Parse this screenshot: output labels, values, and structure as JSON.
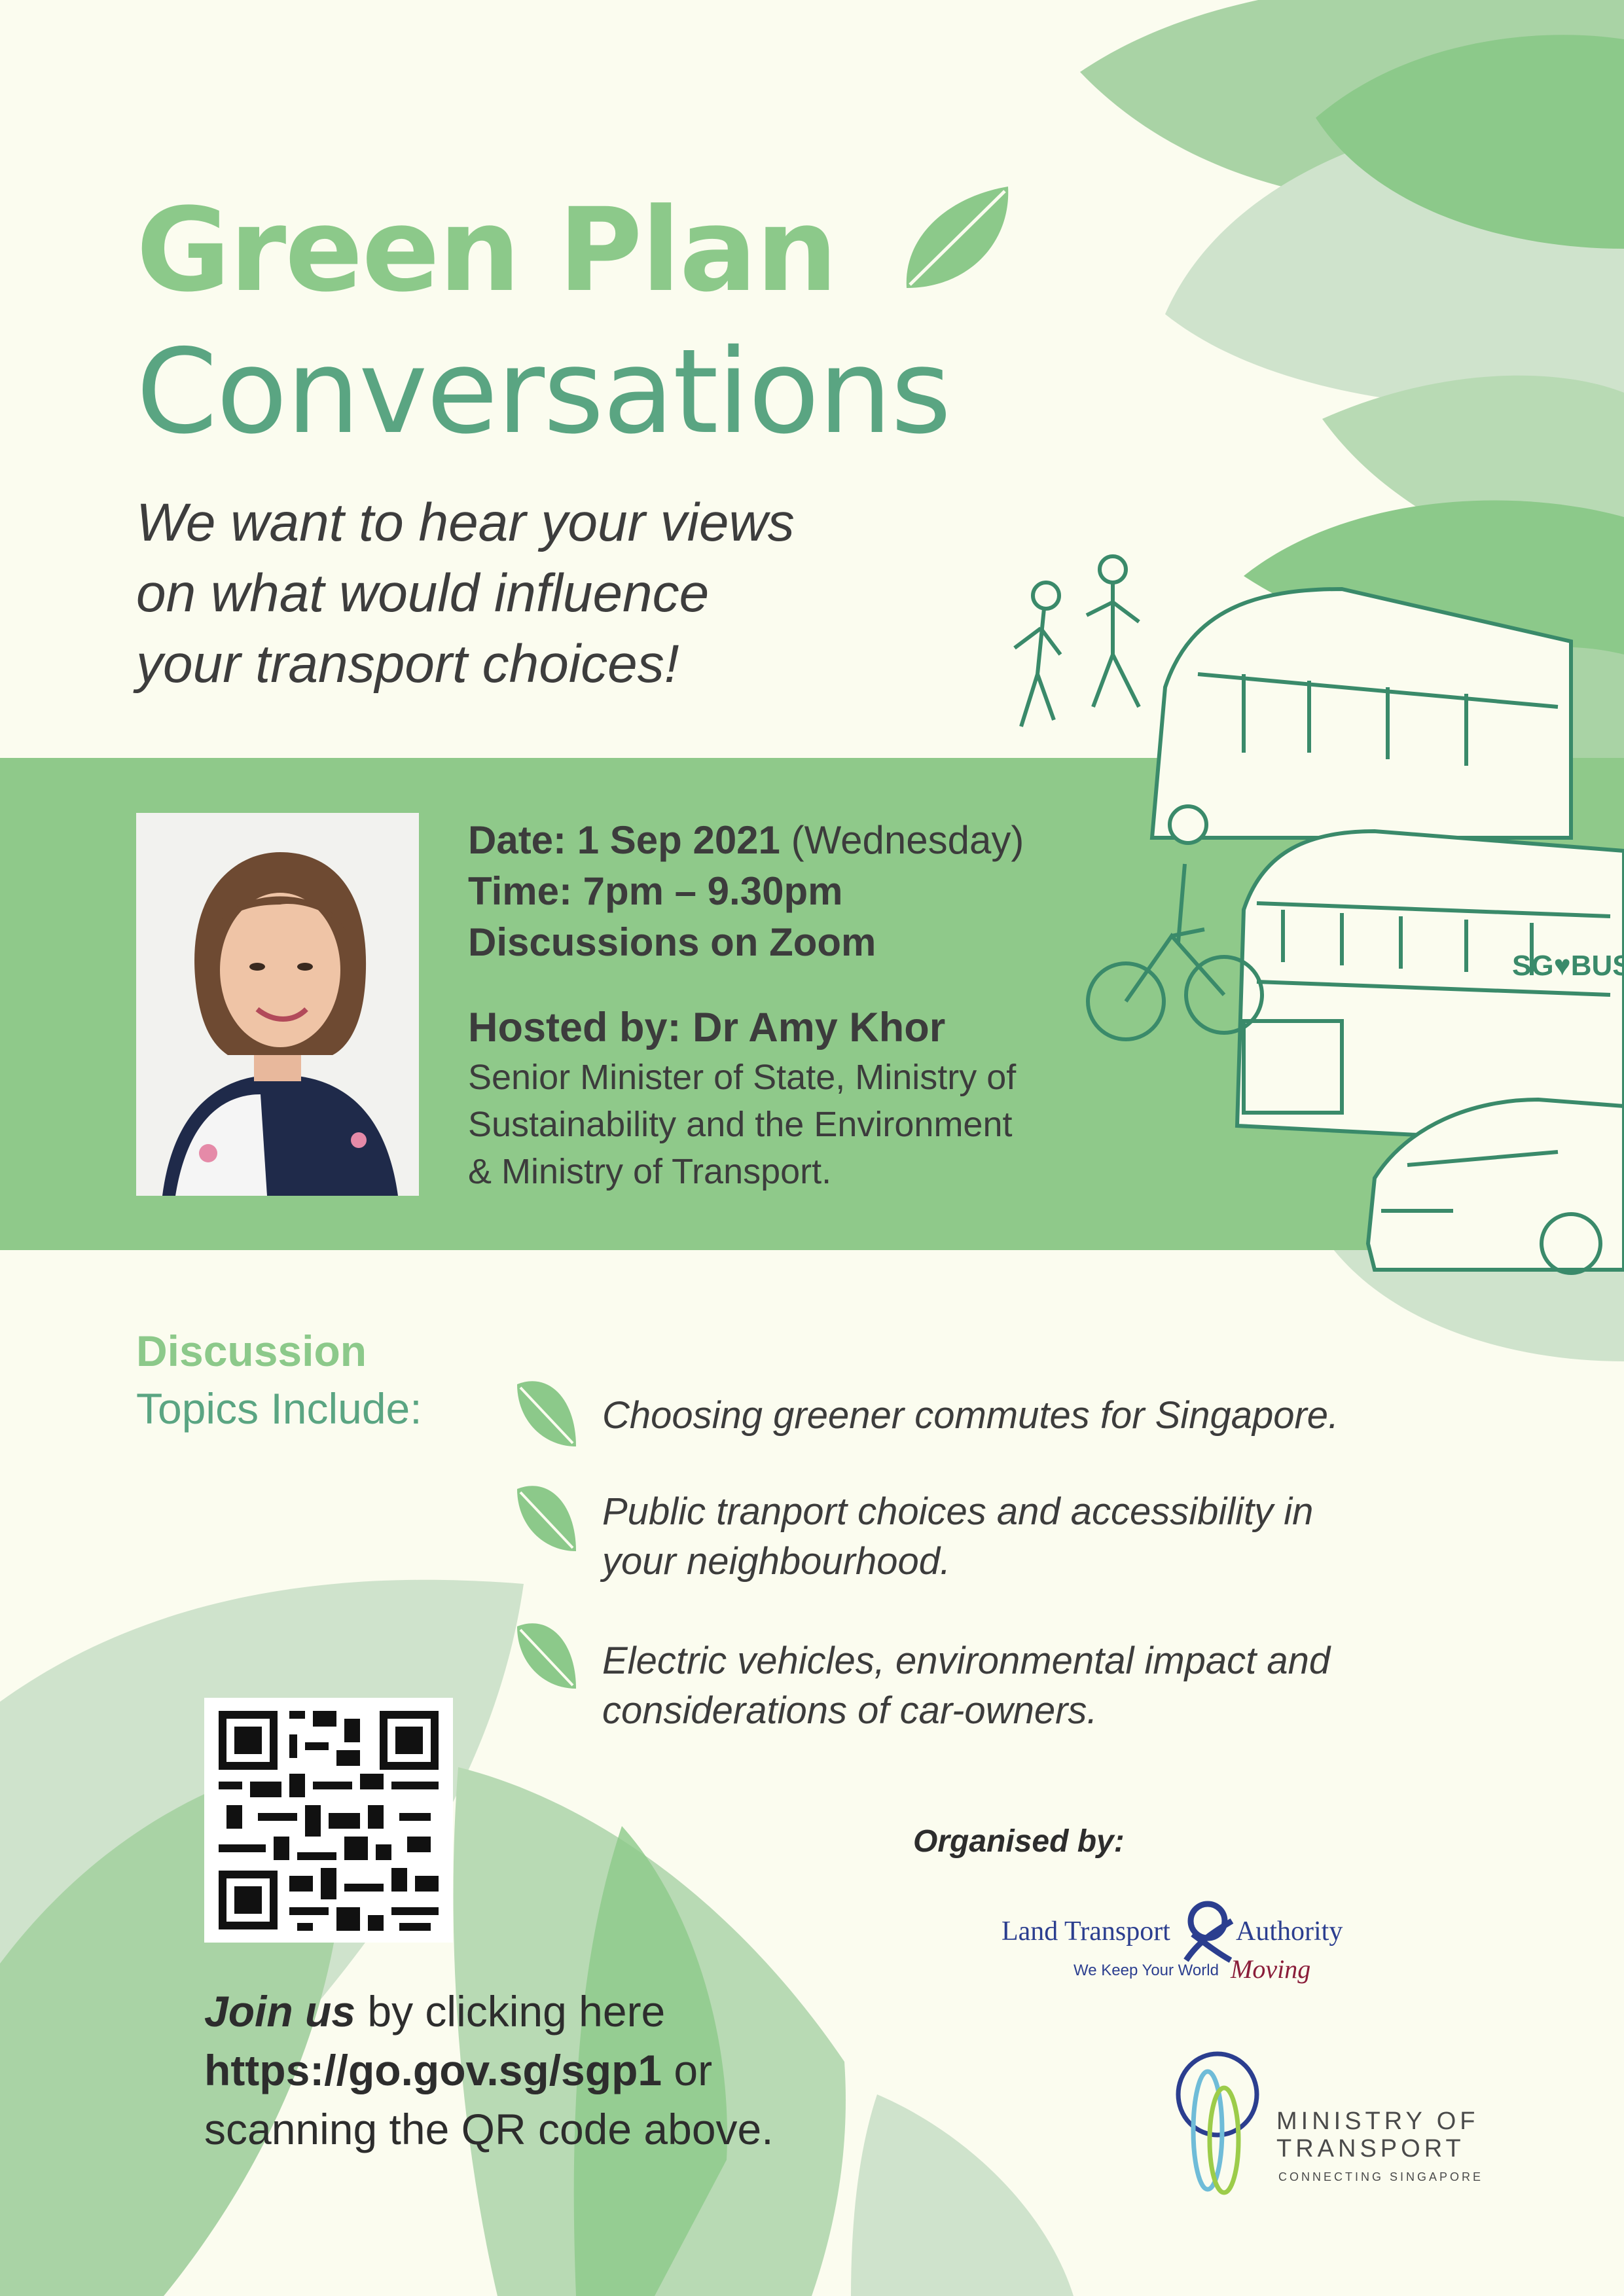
{
  "title": {
    "line1": "Green Plan",
    "line2": "Conversations"
  },
  "intro": {
    "line1": "We want to hear your views",
    "line2": "on what would influence",
    "line3": "your transport choices!"
  },
  "event": {
    "date_label": "Date: 1 Sep 2021",
    "date_day": "(Wednesday)",
    "time": "Time: 7pm – 9.30pm",
    "platform": "Discussions on Zoom"
  },
  "host": {
    "heading": "Hosted by: Dr Amy Khor",
    "line1": "Senior Minister of State, Ministry of",
    "line2": "Sustainability and the Environment",
    "line3": "& Ministry of Transport."
  },
  "topics": {
    "heading1": "Discussion",
    "heading2": "Topics Include:",
    "items": [
      {
        "line1": "Choosing greener commutes for Singapore.",
        "line2": ""
      },
      {
        "line1": "Public tranport choices and accessibility in",
        "line2": "your neighbourhood."
      },
      {
        "line1": "Electric vehicles, environmental impact and",
        "line2": "considerations of car-owners."
      }
    ]
  },
  "join": {
    "lead": "Join us",
    "lead_rest": " by clicking here",
    "url": "https://go.gov.sg/sgp1",
    "url_rest": " or",
    "line3": "scanning the QR code above."
  },
  "organiser": {
    "label": "Organised by:",
    "lta_name_left": "Land Transport",
    "lta_name_right": "Authority",
    "lta_tagline": "We Keep Your World",
    "lta_tagline_script": "Moving",
    "mot_line1": "MINISTRY OF",
    "mot_line2": "TRANSPORT",
    "mot_line3": "CONNECTING SINGAPORE"
  },
  "illustration": {
    "bus_brand": "SG♥BUS"
  },
  "colors": {
    "background": "#fbfcef",
    "band": "#8fc98a",
    "title_light_green": "#8cc98a",
    "title_dark_green": "#5aa582",
    "leaf_light": "#cfe3cc",
    "leaf_mid": "#a9d3a5",
    "leaf_dark": "#8cc98a",
    "lta_blue": "#2b3e8f",
    "lta_maroon": "#8a1d3a"
  }
}
